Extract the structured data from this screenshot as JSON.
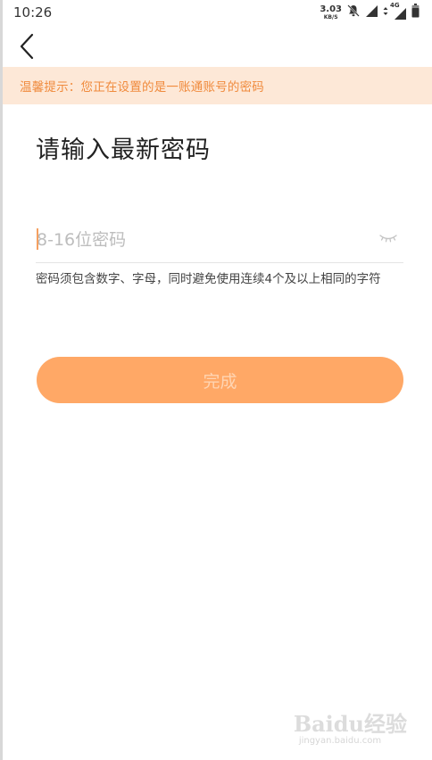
{
  "status_bar": {
    "time": "10:26",
    "net_speed": "3.03",
    "net_speed_unit": "KB/S",
    "network_type": "4G"
  },
  "header": {
    "back_icon": "chevron-left-icon"
  },
  "notice": {
    "text": "温馨提示：您正在设置的是一账通账号的密码"
  },
  "page": {
    "title": "请输入最新密码"
  },
  "password_field": {
    "value": "",
    "placeholder": "8-16位密码",
    "toggle_icon": "eye-closed-icon"
  },
  "hint": {
    "text": "密码须包含数字、字母，同时避免使用连续4个及以上相同的字符"
  },
  "submit": {
    "label": "完成"
  },
  "watermark": {
    "logo": "Baidu经验",
    "url": "jingyan.baidu.com"
  },
  "colors": {
    "accent": "#ffa866",
    "notice_bg": "#fde8d7",
    "notice_text": "#f08a3c",
    "caret": "#f5a061"
  }
}
